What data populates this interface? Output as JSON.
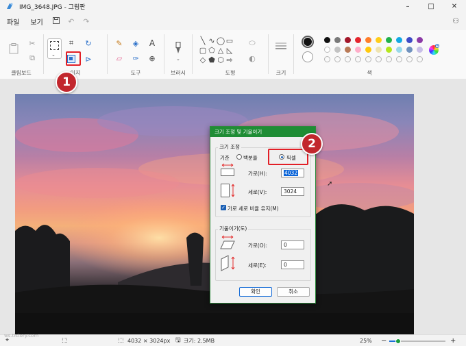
{
  "window": {
    "title": "IMG_3648.JPG - 그림판",
    "controls": [
      "–",
      "□",
      "✕"
    ]
  },
  "menu": {
    "file": "파일",
    "view": "보기",
    "save_icon": "save-icon",
    "undo_icon": "undo-icon",
    "redo_icon": "redo-icon"
  },
  "ribbon": {
    "groups": {
      "clipboard": "클립보드",
      "image": "이지",
      "tools": "도구",
      "brushes": "브러시",
      "shapes": "도형",
      "size": "크기",
      "colors": "색"
    },
    "palette": {
      "primary": "#111111",
      "row1": [
        "#111111",
        "#7a7a7a",
        "#a3172a",
        "#e5262e",
        "#ff7f2a",
        "#ffcd1a",
        "#21b24b",
        "#13a9e4",
        "#3e4bc7",
        "#8c3aa6"
      ],
      "row2": [
        "#ffffff",
        "#c3c3c3",
        "#b97a57",
        "#ffaec9",
        "#ffc90e",
        "#efe4b0",
        "#b5e61d",
        "#99d9ea",
        "#7092be",
        "#c8bfe7"
      ]
    }
  },
  "dialog": {
    "title": "크기 조정 및 기울이기",
    "resize_legend": "크기 조정",
    "basis_label": "기준",
    "percent_label": "백분율",
    "pixel_label": "픽셀",
    "horizontal_label": "가로(H):",
    "horizontal_value": "4032",
    "vertical_label": "세로(V):",
    "vertical_value": "3024",
    "keep_ratio_label": "가로 세로 비율 유지(M)",
    "skew_legend": "기울이기(도)",
    "skew_h_label": "가로(O):",
    "skew_h_value": "0",
    "skew_v_label": "세로(E):",
    "skew_v_value": "0",
    "ok_label": "확인",
    "cancel_label": "취소"
  },
  "callouts": [
    "1",
    "2"
  ],
  "status": {
    "dimensions": "4032 × 3024px",
    "filesize": "크기: 2.5MB",
    "zoom": "25%",
    "zoom_out": "−",
    "zoom_in": "+"
  },
  "watermark": "ws.tistory.com"
}
